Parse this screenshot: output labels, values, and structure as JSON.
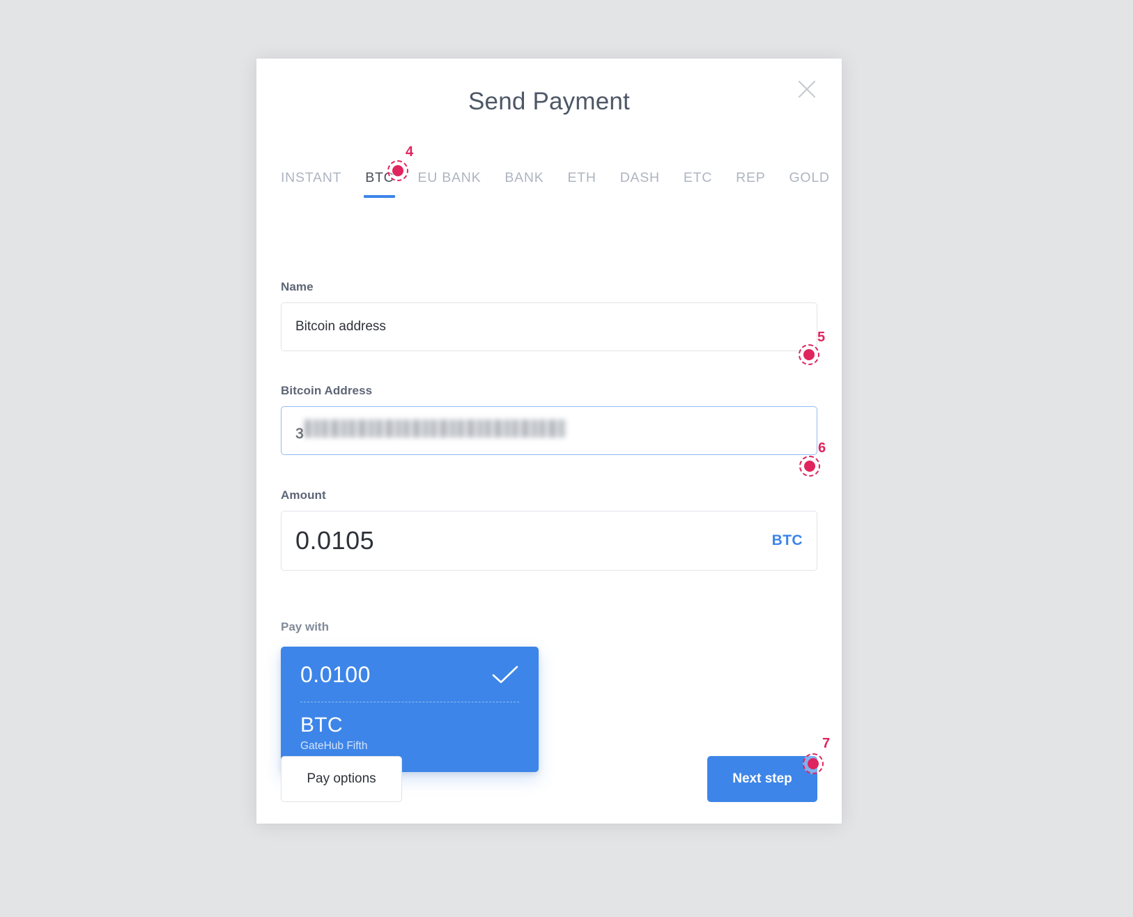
{
  "window": {
    "background_color": "#e3e4e6",
    "accent_color": "#3d85e8",
    "marker_color": "#e0245e"
  },
  "dialog": {
    "title": "Send Payment",
    "close_icon": "close-icon"
  },
  "tabs": [
    {
      "label": "INSTANT",
      "active": false
    },
    {
      "label": "BTC",
      "active": true
    },
    {
      "label": "EU BANK",
      "active": false
    },
    {
      "label": "BANK",
      "active": false
    },
    {
      "label": "ETH",
      "active": false
    },
    {
      "label": "DASH",
      "active": false
    },
    {
      "label": "ETC",
      "active": false
    },
    {
      "label": "REP",
      "active": false
    },
    {
      "label": "GOLD",
      "active": false
    }
  ],
  "form": {
    "name": {
      "label": "Name",
      "value": "Bitcoin address",
      "placeholder": "Name"
    },
    "bitcoin_address": {
      "label": "Bitcoin Address",
      "value_prefix": "3",
      "value_redacted": true,
      "placeholder": "Bitcoin Address",
      "focused": true
    },
    "amount": {
      "label": "Amount",
      "value": "0.0105",
      "currency": "BTC",
      "placeholder": "0.00"
    }
  },
  "pay_with": {
    "label": "Pay with",
    "wallet": {
      "balance": "0.0100",
      "currency": "BTC",
      "issuer": "GateHub Fifth",
      "selected": true,
      "check_icon": "check-icon"
    }
  },
  "actions": {
    "pay_options_label": "Pay options",
    "next_step_label": "Next step"
  },
  "markers": [
    {
      "number": "4",
      "target": "tab-btc"
    },
    {
      "number": "5",
      "target": "bitcoin-address-input"
    },
    {
      "number": "6",
      "target": "amount-input"
    },
    {
      "number": "7",
      "target": "next-step-button"
    }
  ]
}
